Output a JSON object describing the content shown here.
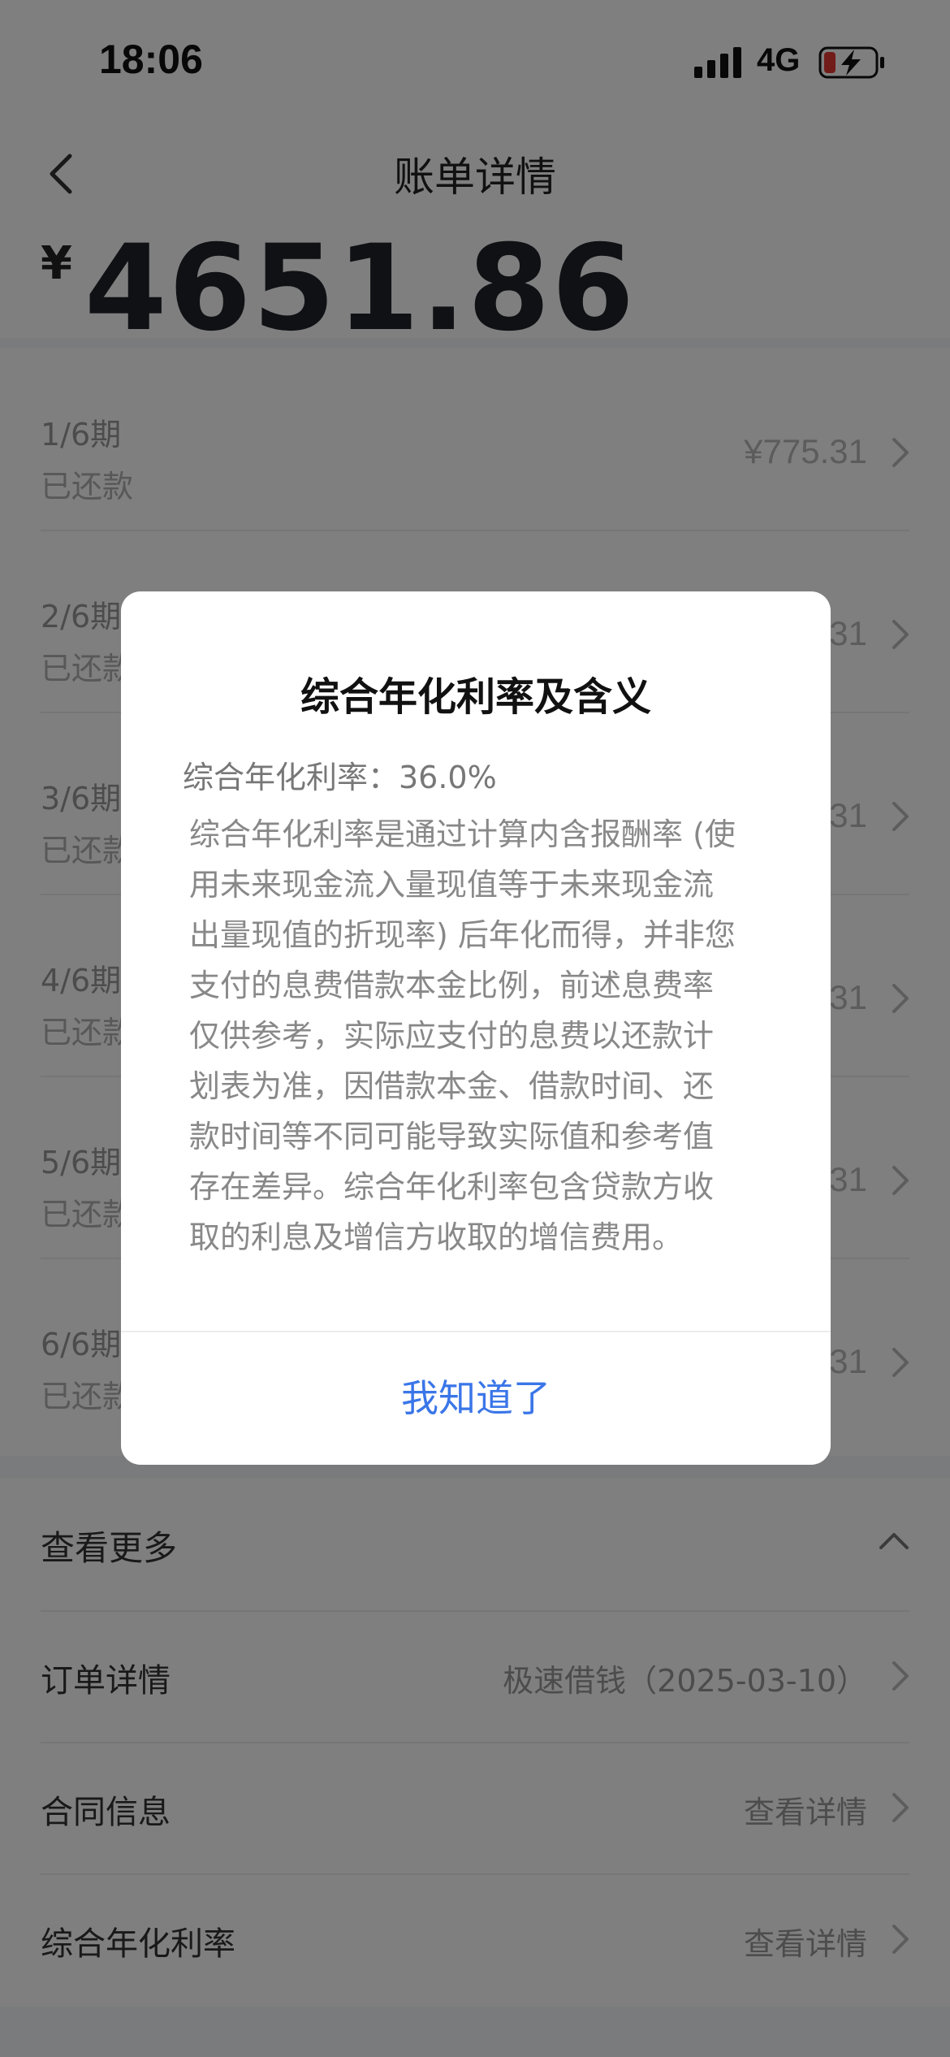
{
  "status_bar": {
    "time": "18:06",
    "network": "4G"
  },
  "nav": {
    "title": "账单详情"
  },
  "amount": {
    "currency": "¥",
    "value": "4651.86"
  },
  "installments": [
    {
      "period": "1/6期",
      "status": "已还款",
      "amount": "¥775.31"
    },
    {
      "period": "2/6期",
      "status": "已还款",
      "amount": "¥775.31"
    },
    {
      "period": "3/6期",
      "status": "已还款",
      "amount": "¥775.31"
    },
    {
      "period": "4/6期",
      "status": "已还款",
      "amount": "¥775.31"
    },
    {
      "period": "5/6期",
      "status": "已还款",
      "amount": "¥775.31"
    },
    {
      "period": "6/6期",
      "status": "已还款",
      "amount": "¥775.31"
    }
  ],
  "more": {
    "title": "查看更多",
    "rows": [
      {
        "label": "订单详情",
        "value": "极速借钱（2025-03-10）"
      },
      {
        "label": "合同信息",
        "value": "查看详情"
      },
      {
        "label": "综合年化利率",
        "value": "查看详情"
      }
    ]
  },
  "modal": {
    "title": "综合年化利率及含义",
    "rate_line": "综合年化利率：36.0%",
    "body_lines": [
      "综合年化利率是通过计算内含报酬率 (使",
      "用未来现金流入量现值等于未来现金流",
      "出量现值的折现率) 后年化而得，并非您",
      "支付的息费借款本金比例，前述息费率",
      "仅供参考，实际应支付的息费以还款计",
      "划表为准，因借款本金、借款时间、还",
      "款时间等不同可能导致实际值和参考值",
      "存在差异。综合年化利率包含贷款方收",
      "取的利息及增信方收取的增信费用。"
    ],
    "button_label": "我知道了"
  },
  "colors": {
    "accent": "#3a76e8",
    "overlay": "rgba(0,0,0,0.5)",
    "battery_low": "#e53935"
  }
}
